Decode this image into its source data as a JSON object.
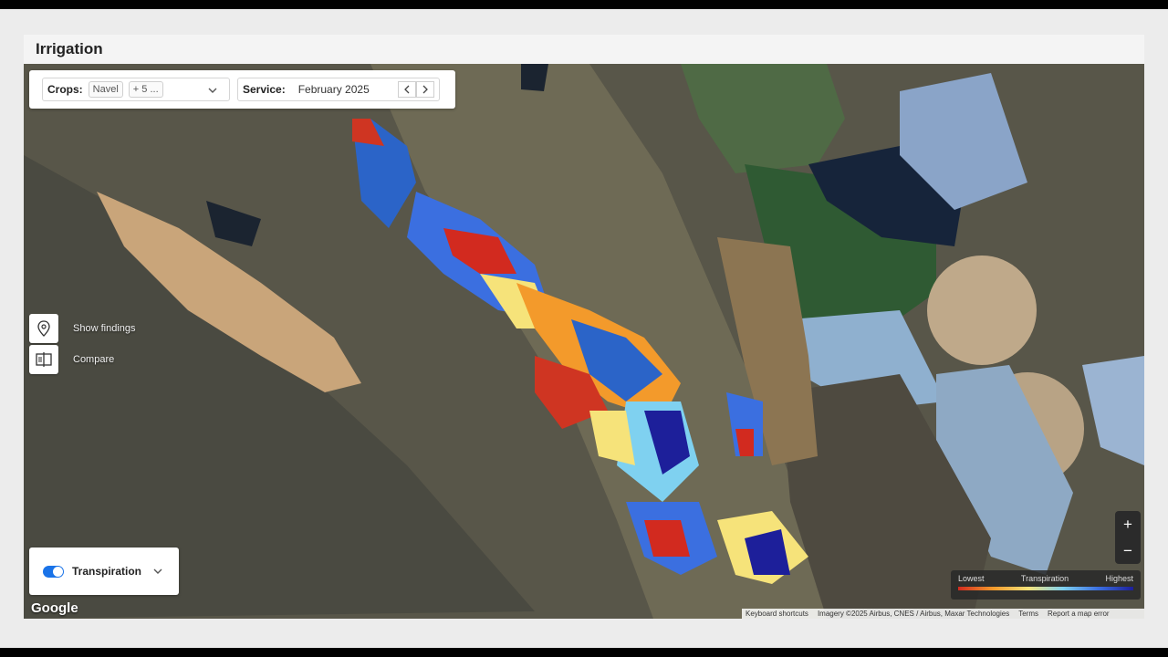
{
  "app": {
    "title": "Irrigation"
  },
  "filters": {
    "crops_label": "Crops:",
    "crop_chip": "Navel",
    "crop_more": "+ 5 ...",
    "service_label": "Service:",
    "service_value": "February 2025"
  },
  "side_tools": {
    "findings_label": "Show findings",
    "compare_label": "Compare"
  },
  "layer": {
    "label": "Transpiration",
    "enabled": true
  },
  "legend": {
    "low": "Lowest",
    "mid": "Transpiration",
    "high": "Highest"
  },
  "attribution": {
    "shortcuts": "Keyboard shortcuts",
    "imagery": "Imagery ©2025 Airbus, CNES / Airbus, Maxar Technologies",
    "terms": "Terms",
    "report": "Report a map error"
  },
  "map_brand": "Google",
  "zoom": {
    "in": "+",
    "out": "−"
  },
  "colors": {
    "low": "#d22a1f",
    "mid_low": "#f39a2b",
    "mid": "#f6e37a",
    "mid_high": "#7fd1f0",
    "high": "#1d1f9a",
    "toggle_on": "#1a73e8"
  }
}
